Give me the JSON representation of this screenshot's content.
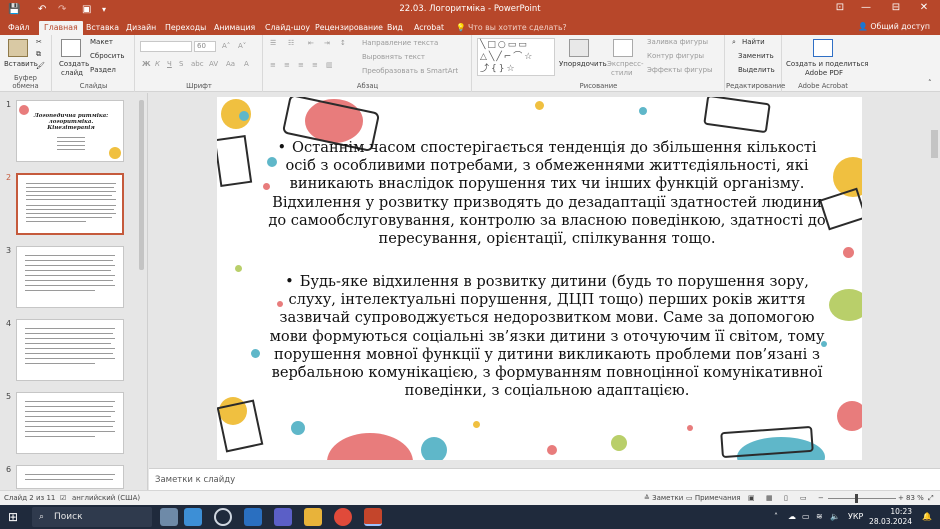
{
  "titlebar": {
    "title": "22.03. Логоритміка - PowerPoint",
    "account_initials": "",
    "min_label": "—",
    "max_label": "☐",
    "close_label": "✕",
    "restore_label": "⊟"
  },
  "tabs": {
    "items": [
      "Файл",
      "Главная",
      "Вставка",
      "Дизайн",
      "Переходы",
      "Анимация",
      "Слайд-шоу",
      "Рецензирование",
      "Вид",
      "Acrobat"
    ],
    "active": "Главная",
    "tellme": "Что вы хотите сделать?",
    "share": "Общий доступ"
  },
  "ribbon": {
    "clipboard": {
      "label": "Буфер обмена",
      "paste": "Вставить"
    },
    "slides": {
      "label": "Слайды",
      "create": "Создать",
      "create2": "слайд",
      "layout": "Макет",
      "reset": "Сбросить",
      "section": "Раздел"
    },
    "font": {
      "label": "Шрифт",
      "size": "60"
    },
    "paragraph": {
      "label": "Абзац",
      "direction": "Направление текста",
      "align": "Выровнять текст",
      "smartart": "Преобразовать в SmartArt"
    },
    "drawing": {
      "label": "Рисование",
      "arrange": "Упорядочить",
      "styles": "Экспресс-",
      "styles2": "стили",
      "fill": "Заливка фигуры",
      "outline": "Контур фигуры",
      "effects": "Эффекты фигуры"
    },
    "editing": {
      "label": "Редактирование",
      "find": "Найти",
      "replace": "Заменить",
      "select": "Выделить"
    },
    "acrobat": {
      "label": "Adobe Acrobat",
      "create": "Создать и поделиться",
      "create2": "Adobe PDF"
    }
  },
  "thumbnails": {
    "numbers": [
      "1",
      "2",
      "3",
      "4",
      "5",
      "6"
    ],
    "slide1_title": "Логопедична ритміка: логоритміка. Кінезітерапія",
    "selected": "2"
  },
  "slide": {
    "bullet_symbol": "•",
    "paragraph1": "Останнім часом спостерігається тенденція до збільшення кількості осіб з особливими потребами, з обмеженнями життєдіяльності, які виникають внаслідок порушення тих чи інших функцій організму. Відхилення у розвитку призводять до дезадаптації здатностей людини до  самообслуговування, контролю за власною поведінкою, здатності до пересування, орієнтації, спілкування тощо.",
    "paragraph2": "Будь-яке відхилення в розвитку дитини (будь то порушення зору, слуху, інтелектуальні порушення, ДЦП тощо) перших років життя зазвичай супроводжується недорозвитком мови. Саме за допомогою мови формуються соціальні зв’язки дитини з оточуючим її світом, тому порушення мовної функції у дитини викликають проблеми пов’язані з вербальною комунікацією, з формуванням повноцінної комунікативної поведінки, з соціальною адаптацією."
  },
  "notes": {
    "placeholder": "Заметки к слайду"
  },
  "statusbar": {
    "slide_counter": "Слайд 2 из 11",
    "language": "английский (США)",
    "notes": "Заметки",
    "comments": "Примечания",
    "zoom": "83 %"
  },
  "taskbar": {
    "search": "Поиск",
    "lang": "УКР",
    "time": "10:23",
    "date": "28.03.2024"
  },
  "colors": {
    "accent": "#b7472a",
    "dot_red": "#e87c7c",
    "dot_green": "#b9cf6a",
    "dot_teal": "#5fb7c9",
    "dot_yellow": "#f0c040"
  }
}
